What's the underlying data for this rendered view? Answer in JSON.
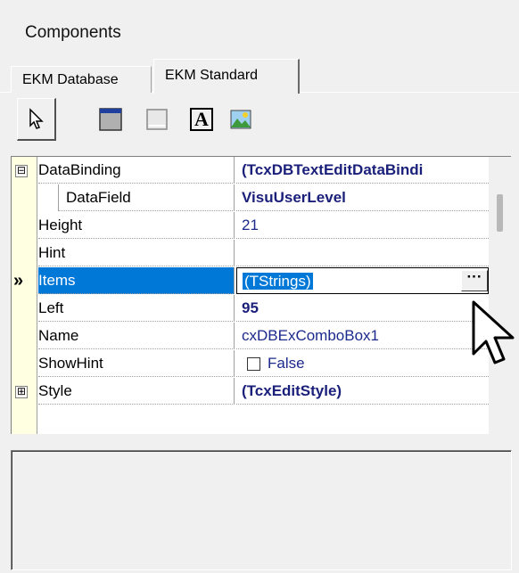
{
  "panel": {
    "title": "Components"
  },
  "tabs": [
    {
      "label": "EKM Database",
      "active": false
    },
    {
      "label": "EKM Standard",
      "active": true
    }
  ],
  "toolbar": {
    "tools": [
      "pointer-icon",
      "panel-icon",
      "frame-icon",
      "label-icon",
      "image-icon"
    ],
    "label_glyph": "A"
  },
  "inspector": {
    "selected_marker": "»",
    "rows": [
      {
        "name": "DataBinding",
        "value": "(TcxDBTextEditDataBindi",
        "expander": "⊟",
        "bold": true
      },
      {
        "name": "DataField",
        "value": "VisuUserLevel",
        "bold": true
      },
      {
        "name": "Height",
        "value": "21"
      },
      {
        "name": "Hint",
        "value": ""
      },
      {
        "name": "Items",
        "value": "(TStrings)",
        "button": "···"
      },
      {
        "name": "Left",
        "value": "95",
        "bold": true
      },
      {
        "name": "Name",
        "value": "cxDBExComboBox1"
      },
      {
        "name": "ShowHint",
        "value": "False"
      },
      {
        "name": "Style",
        "value": "(TcxEditStyle)",
        "expander": "⊞",
        "bold": true
      }
    ]
  }
}
